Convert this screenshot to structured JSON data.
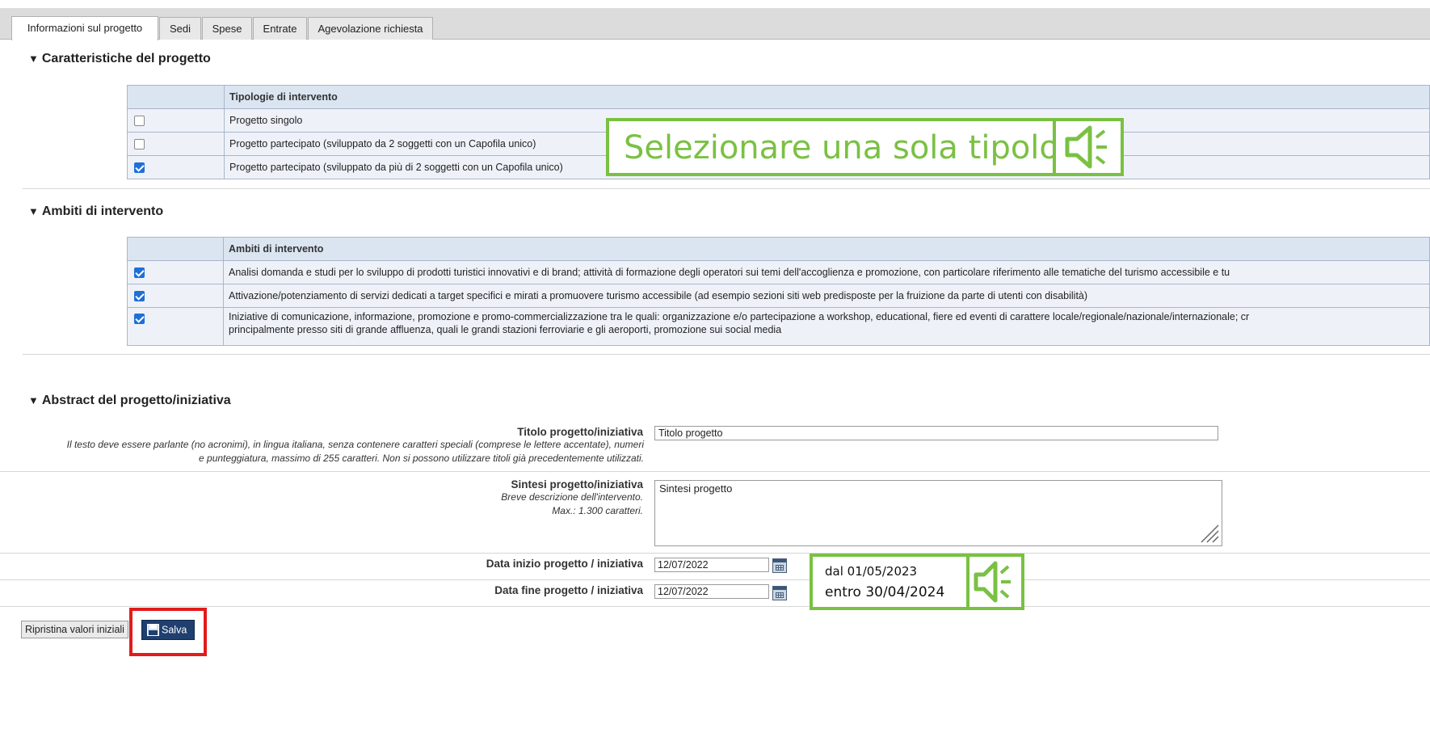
{
  "tabs": [
    {
      "label": "Informazioni sul progetto",
      "active": true
    },
    {
      "label": "Sedi",
      "active": false
    },
    {
      "label": "Spese",
      "active": false
    },
    {
      "label": "Entrate",
      "active": false
    },
    {
      "label": "Agevolazione richiesta",
      "active": false
    }
  ],
  "section1": {
    "title": "Caratteristiche del progetto",
    "header": "Tipologie di intervento",
    "rows": [
      {
        "label": "Progetto singolo",
        "checked": false
      },
      {
        "label": "Progetto partecipato (sviluppato da 2 soggetti con un Capofila unico)",
        "checked": false
      },
      {
        "label": "Progetto partecipato (sviluppato da più di 2 soggetti con un Capofila unico)",
        "checked": true
      }
    ]
  },
  "callout1": {
    "text": "Selezionare una sola tipologia",
    "icon": "speaker-icon"
  },
  "section2": {
    "title": "Ambiti di intervento",
    "header": "Ambiti di intervento",
    "rows": [
      {
        "label": "Analisi domanda e studi per lo sviluppo di prodotti turistici innovativi e di brand; attività di formazione degli operatori sui temi dell'accoglienza e promozione, con particolare riferimento alle tematiche del turismo accessibile e tu",
        "checked": true
      },
      {
        "label": "Attivazione/potenziamento di servizi dedicati a target specifici e mirati a promuovere turismo accessibile (ad esempio sezioni siti web predisposte per la fruizione da parte di utenti con disabilità)",
        "checked": true
      },
      {
        "label": "Iniziative di comunicazione, informazione, promozione e promo-commercializzazione tra le quali: organizzazione e/o partecipazione a workshop, educational, fiere ed eventi di carattere locale/regionale/nazionale/internazionale; cr",
        "label2": "principalmente presso siti di grande affluenza, quali le grandi stazioni ferroviarie e gli aeroporti, promozione sui social media",
        "checked": true
      }
    ]
  },
  "section3": {
    "title": "Abstract del progetto/iniziativa",
    "titolo": {
      "label": "Titolo progetto/iniziativa",
      "hint1": "Il testo deve essere parlante (no acronimi), in lingua italiana, senza contenere caratteri speciali (comprese le lettere accentate), numeri",
      "hint2": "e punteggiatura, massimo di 255 caratteri. Non si possono utilizzare titoli già precedentemente utilizzati.",
      "value": "Titolo progetto"
    },
    "sintesi": {
      "label": "Sintesi progetto/iniziativa",
      "hint1": "Breve descrizione dell'intervento.",
      "hint2": "Max.: 1.300 caratteri.",
      "value": "Sintesi progetto"
    },
    "data_inizio": {
      "label": "Data inizio progetto / iniziativa",
      "value": "12/07/2022"
    },
    "data_fine": {
      "label": "Data fine progetto / iniziativa",
      "value": "12/07/2022"
    }
  },
  "callout2": {
    "line1": "dal 01/05/2023",
    "line2": "entro 30/04/2024",
    "icon": "speaker-icon"
  },
  "buttons": {
    "reset": "Ripristina valori iniziali",
    "save": "Salva"
  },
  "colors": {
    "accent_green": "#7ac143",
    "highlight_red": "#e21b1b",
    "save_blue": "#1f3f6e"
  }
}
